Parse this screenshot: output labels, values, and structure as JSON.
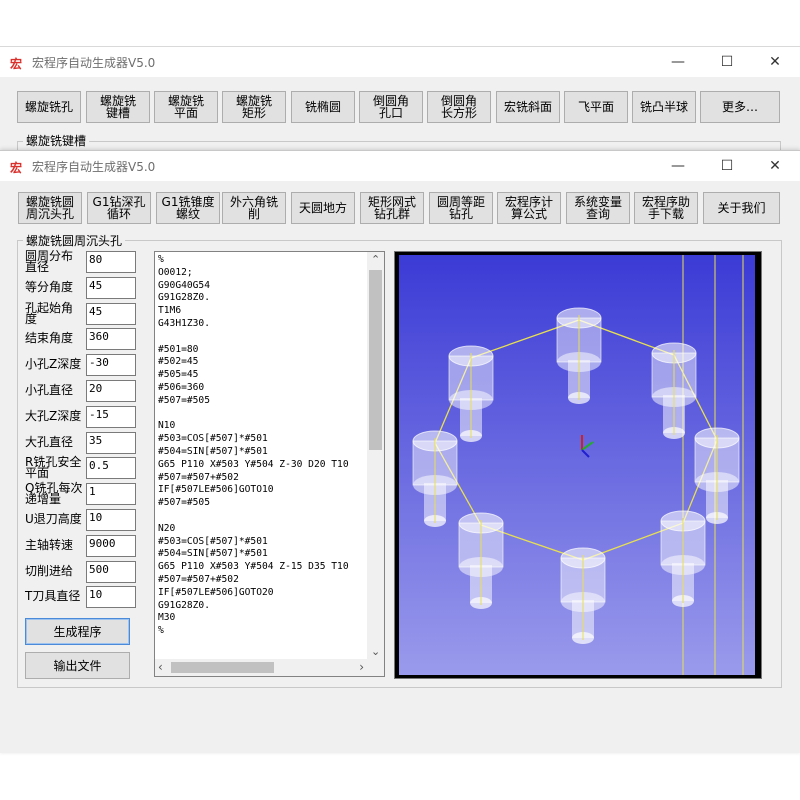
{
  "back_window": {
    "app_icon": "宏",
    "title": "宏程序自动生成器V5.0",
    "toolbar": [
      "螺旋铣孔",
      "螺旋铣\n键槽",
      "螺旋铣\n平面",
      "螺旋铣\n矩形",
      "铣椭圆",
      "倒圆角\n孔口",
      "倒圆角\n长方形",
      "宏铣斜面",
      "飞平面",
      "铣凸半球",
      "更多…"
    ],
    "group_label": "螺旋铣键槽"
  },
  "front_window": {
    "app_icon": "宏",
    "title": "宏程序自动生成器V5.0",
    "window_controls": [
      "minimize-icon",
      "maximize-icon",
      "close-icon"
    ],
    "toolbar": [
      "螺旋铣圆\n周沉头孔",
      "G1钻深孔\n循环",
      "G1铣锥度\n螺纹",
      "外六角铣\n削",
      "天圆地方",
      "矩形网式\n钻孔群",
      "圆周等距\n钻孔",
      "宏程序计\n算公式",
      "系统变量\n查询",
      "宏程序助\n手下载",
      "关于我们"
    ],
    "group_label": "螺旋铣圆周沉头孔",
    "fields": [
      {
        "label": "圆周分布\n直径",
        "value": "80"
      },
      {
        "label": "等分角度",
        "value": "45"
      },
      {
        "label": "孔起始角\n度",
        "value": "45"
      },
      {
        "label": "结束角度",
        "value": "360"
      },
      {
        "label": "小孔Z深度",
        "value": "-30"
      },
      {
        "label": "小孔直径",
        "value": "20"
      },
      {
        "label": "大孔Z深度",
        "value": "-15"
      },
      {
        "label": "大孔直径",
        "value": "35"
      },
      {
        "label": "R铣孔安全\n平面",
        "value": "0.5"
      },
      {
        "label": "Q铣孔每次\n递增量",
        "value": "1"
      },
      {
        "label": "U退刀高度",
        "value": "10"
      },
      {
        "label": "主轴转速",
        "value": "9000"
      },
      {
        "label": "切削进给",
        "value": "500"
      },
      {
        "label": "T刀具直径",
        "value": "10"
      }
    ],
    "generate_button": "生成程序",
    "export_button": "输出文件",
    "code_text": "%\nO0012;\nG90G40G54\nG91G28Z0.\nT1M6\nG43H1Z30.\n\n#501=80\n#502=45\n#505=45\n#506=360\n#507=#505\n\nN10\n#503=COS[#507]*#501\n#504=SIN[#507]*#501\nG65 P110 X#503 Y#504 Z-30 D20 T10\n#507=#507+#502\nIF[#507LE#506]GOTO10\n#507=#505\n\nN20\n#503=COS[#507]*#501\n#504=SIN[#507]*#501\nG65 P110 X#503 Y#504 Z-15 D35 T10\n#507=#507+#502\nIF[#507LE#506]GOTO20\nG91G28Z0.\nM30\n%"
  },
  "colors": {
    "viewport_bg_top": "#3b3bd6",
    "viewport_bg_bottom": "#9a9aec",
    "toolpath": "#e8e050",
    "hole": "#ffffff"
  }
}
